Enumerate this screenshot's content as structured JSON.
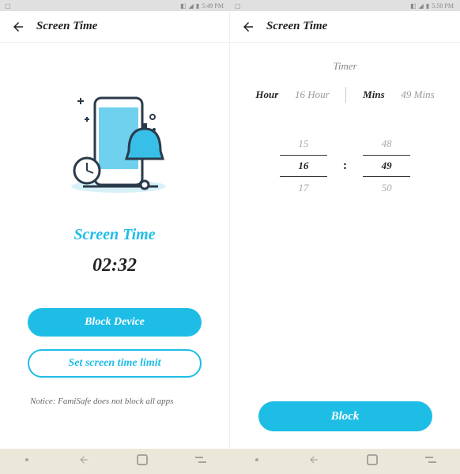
{
  "status": {
    "left_time": "5:49 PM",
    "right_time": "5:50 PM"
  },
  "left": {
    "header_title": "Screen Time",
    "label": "Screen Time",
    "time": "02:32",
    "block_button": "Block Device",
    "limit_button": "Set screen time limit",
    "notice": "Notice: FamiSafe does not block all apps"
  },
  "right": {
    "header_title": "Screen Time",
    "timer_label": "Timer",
    "tabs": {
      "hour_label": "Hour",
      "hour_value": "16 Hour",
      "mins_label": "Mins",
      "mins_value": "49 Mins"
    },
    "picker": {
      "hour_prev": "15",
      "hour_sel": "16",
      "hour_next": "17",
      "min_prev": "48",
      "min_sel": "49",
      "min_next": "50"
    },
    "block_button": "Block"
  }
}
